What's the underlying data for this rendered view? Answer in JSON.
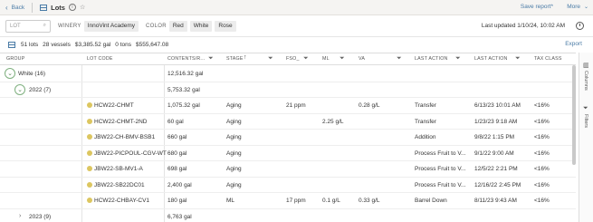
{
  "topbar": {
    "back_label": "Back",
    "title": "Lots",
    "save_report_label": "Save report*",
    "more_label": "More"
  },
  "filters": {
    "lot_placeholder": "LOT",
    "winery_label": "WINERY",
    "winery_value": "InnoVint Academy",
    "color_label": "COLOR",
    "colors": [
      "Red",
      "White",
      "Rose"
    ],
    "last_updated": "Last updated 1/10/24, 10:02 AM"
  },
  "summary": {
    "lots": "51 lots",
    "vessels": "28 vessels",
    "cost": "$3,385.52 gal",
    "tons": "0 tons",
    "value": "$555,647.08",
    "export_label": "Export"
  },
  "columns": [
    "GROUP",
    "LOT CODE",
    "CONTENTS/R...",
    "STAGE",
    "FSO_",
    "ML",
    "VA",
    "LAST ACTION",
    "LAST ACTION",
    "TAX CLASS"
  ],
  "groups": {
    "white": {
      "label": "White (16)",
      "contents": "12,516.32 gal"
    },
    "y2022": {
      "label": "2022 (7)",
      "contents": "5,753.32 gal"
    },
    "y2023": {
      "label": "2023 (9)",
      "contents": "6,763 gal"
    }
  },
  "rows": [
    {
      "lot": "HCW22-CHMT",
      "contents": "1,075.32 gal",
      "stage": "Aging",
      "fso": "21 ppm",
      "ml": "",
      "va": "0.28 g/L",
      "action": "Transfer",
      "date": "6/13/23 10:01 AM",
      "tax": "<16%"
    },
    {
      "lot": "HCW22-CHMT-2ND",
      "contents": "60 gal",
      "stage": "Aging",
      "fso": "",
      "ml": "2.25 g/L",
      "va": "",
      "action": "Transfer",
      "date": "1/23/23 9:18 AM",
      "tax": "<16%"
    },
    {
      "lot": "JBW22-CH-BMV-BSB1",
      "contents": "660 gal",
      "stage": "Aging",
      "fso": "",
      "ml": "",
      "va": "",
      "action": "Addition",
      "date": "9/8/22 1:15 PM",
      "tax": "<16%"
    },
    {
      "lot": "JBW22-PICPOUL-CGV-WT",
      "contents": "680 gal",
      "stage": "Aging",
      "fso": "",
      "ml": "",
      "va": "",
      "action": "Process Fruit to V...",
      "date": "9/1/22 9:00 AM",
      "tax": "<16%"
    },
    {
      "lot": "JBW22-SB-MV1-A",
      "contents": "698 gal",
      "stage": "Aging",
      "fso": "",
      "ml": "",
      "va": "",
      "action": "Process Fruit to V...",
      "date": "12/5/22 2:21 PM",
      "tax": "<16%"
    },
    {
      "lot": "JBW22-SB22DC01",
      "contents": "2,400 gal",
      "stage": "Aging",
      "fso": "",
      "ml": "",
      "va": "",
      "action": "Process Fruit to V...",
      "date": "12/16/22 2:45 PM",
      "tax": "<16%"
    },
    {
      "lot": "HCW22-CHBAY-CV1",
      "contents": "180 gal",
      "stage": "ML",
      "fso": "17 ppm",
      "ml": "0.1 g/L",
      "va": "0.33 g/L",
      "action": "Barrel Down",
      "date": "8/11/23 9:43 AM",
      "tax": "<16%"
    }
  ],
  "side": {
    "columns_label": "Columns",
    "filters_label": "Filters"
  },
  "accent": "#4a7ba6",
  "dot_color": "#dcc660"
}
